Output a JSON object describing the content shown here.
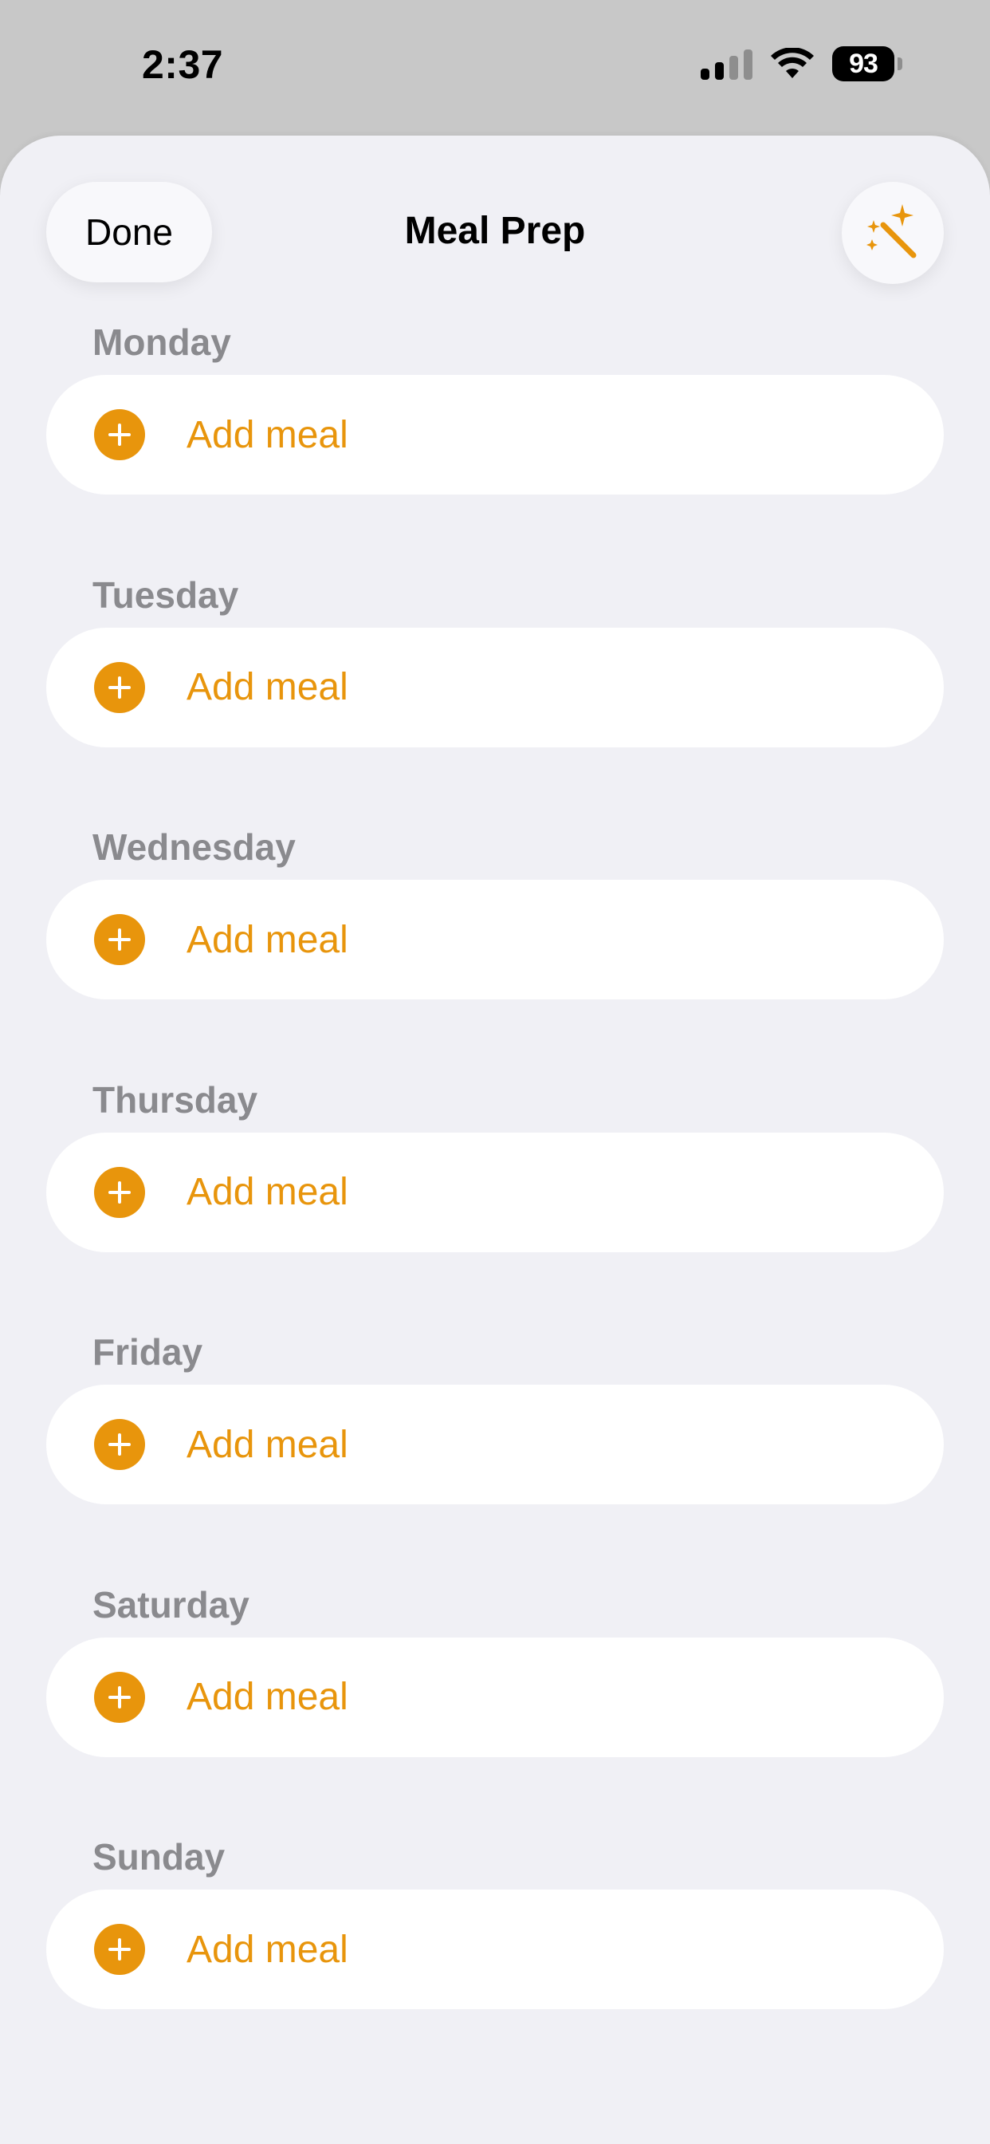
{
  "status_bar": {
    "time": "2:37",
    "battery": "93",
    "icons": [
      "cellular-signal-icon",
      "wifi-icon",
      "battery-icon"
    ]
  },
  "header": {
    "done_label": "Done",
    "title": "Meal Prep",
    "action_icon": "magic-wand-icon"
  },
  "days": [
    {
      "label": "Monday",
      "add_label": "Add meal"
    },
    {
      "label": "Tuesday",
      "add_label": "Add meal"
    },
    {
      "label": "Wednesday",
      "add_label": "Add meal"
    },
    {
      "label": "Thursday",
      "add_label": "Add meal"
    },
    {
      "label": "Friday",
      "add_label": "Add meal"
    },
    {
      "label": "Saturday",
      "add_label": "Add meal"
    },
    {
      "label": "Sunday",
      "add_label": "Add meal"
    }
  ],
  "colors": {
    "accent": "#e8950c",
    "sheet_background": "#f0f0f5",
    "row_background": "#ffffff",
    "section_label": "#8a8a8e"
  }
}
